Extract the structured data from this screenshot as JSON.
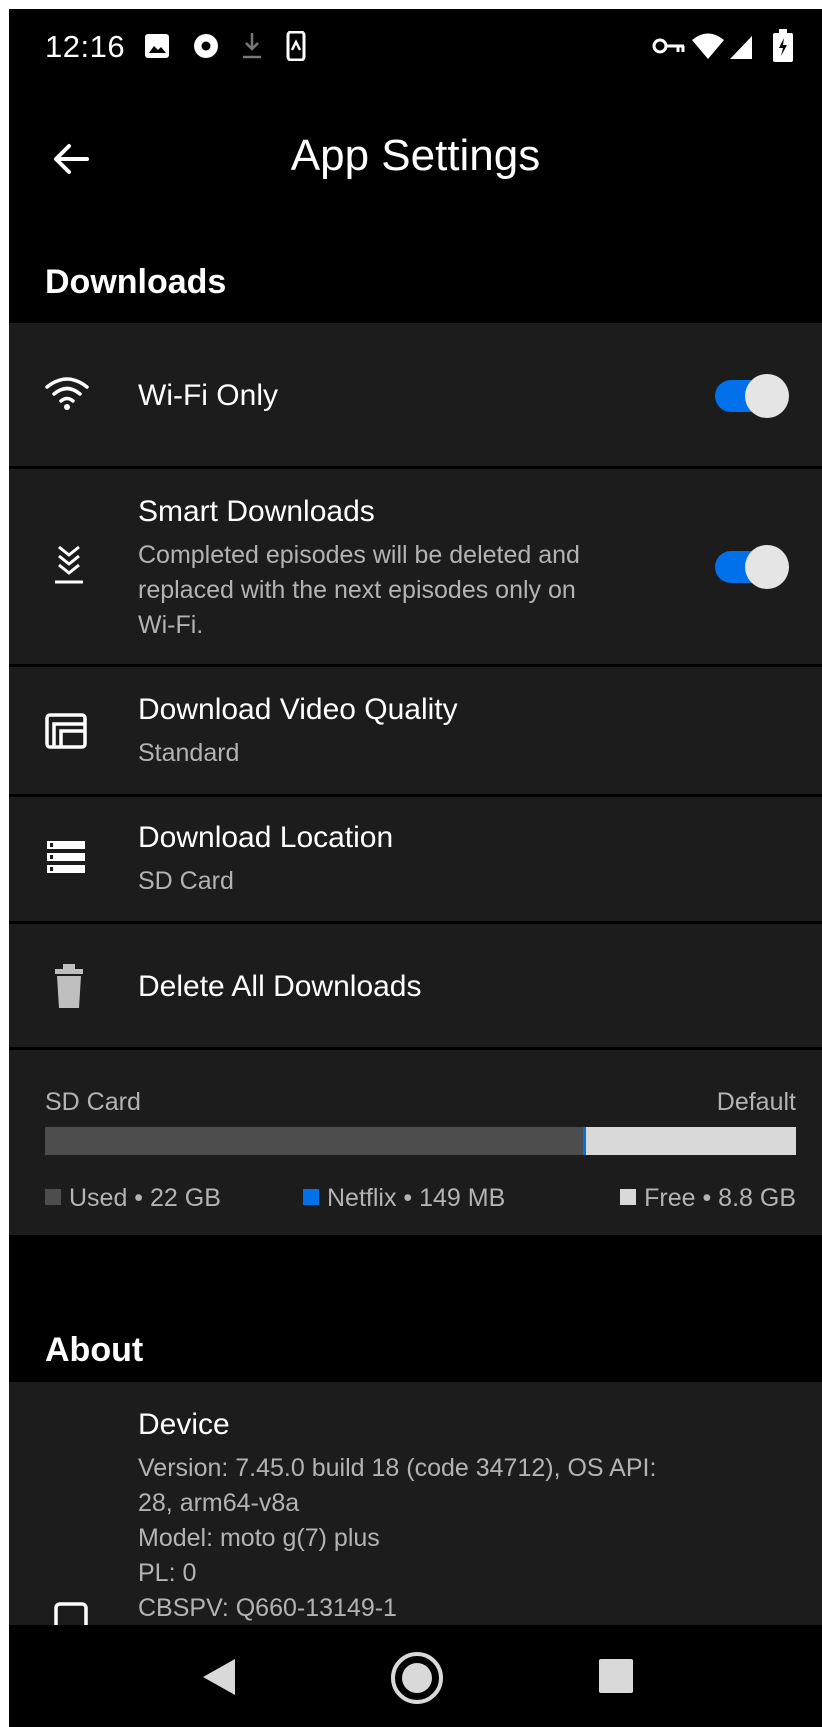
{
  "status_bar": {
    "time": "12:16",
    "icons": [
      "image-icon",
      "record-icon",
      "download-arrow-icon",
      "phone-sync-icon",
      "vpn-key-icon",
      "wifi-icon",
      "signal-icon",
      "battery-icon"
    ]
  },
  "header": {
    "back_icon": "back-arrow-icon",
    "title": "App Settings"
  },
  "downloads_section": {
    "title": "Downloads",
    "items": [
      {
        "icon": "wifi-icon",
        "title": "Wi-Fi Only",
        "toggle_on": true
      },
      {
        "icon": "smart-downloads-icon",
        "title": "Smart Downloads",
        "subtitle_lines": [
          "Completed episodes will be deleted and",
          "replaced with the next episodes only on",
          "Wi-Fi."
        ],
        "toggle_on": true
      },
      {
        "icon": "video-quality-icon",
        "title": "Download Video Quality",
        "subtitle": "Standard"
      },
      {
        "icon": "storage-location-icon",
        "title": "Download Location",
        "subtitle": "SD Card"
      },
      {
        "icon": "trash-icon",
        "title": "Delete All Downloads"
      }
    ]
  },
  "storage": {
    "name": "SD Card",
    "tag": "Default",
    "used_fraction": 0.716,
    "netflix_fraction": 0.004,
    "legend": [
      {
        "label": "Used • 22 GB",
        "color": "#4d4d4d"
      },
      {
        "label": "Netflix • 149 MB",
        "color": "#0071eb"
      },
      {
        "label": "Free • 8.8 GB",
        "color": "#d9d9d9"
      }
    ]
  },
  "about_section": {
    "title": "About",
    "device": {
      "icon": "phone-icon",
      "title": "Device",
      "lines": [
        "Version: 7.45.0 build 18 (code 34712), OS API:",
        "28, arm64-v8a",
        "Model: moto g(7) plus",
        "PL: 0",
        "CBSPV: Q660-13149-1"
      ]
    }
  },
  "nav_bar": {
    "buttons": [
      "back-triangle-icon",
      "home-circle-icon",
      "recents-square-icon"
    ]
  },
  "colors": {
    "background": "#000000",
    "row_background": "#1c1c1c",
    "accent": "#0071eb",
    "secondary_text": "#b3b3b3"
  }
}
